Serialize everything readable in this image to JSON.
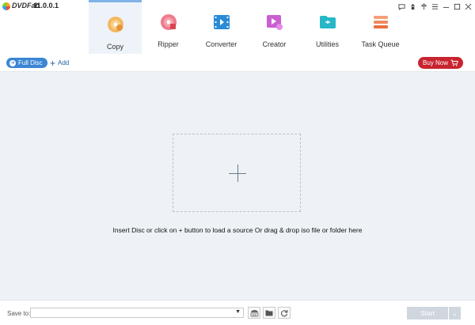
{
  "app": {
    "name": "DVDFab",
    "version": "11.0.0.1"
  },
  "toolbar": {
    "items": [
      {
        "label": "Copy",
        "icon": "copy-disc-icon",
        "active": true,
        "color": "#f0a640"
      },
      {
        "label": "Ripper",
        "icon": "ripper-disc-icon",
        "active": false,
        "color": "#e8556a"
      },
      {
        "label": "Converter",
        "icon": "converter-film-icon",
        "active": false,
        "color": "#2a8bd6"
      },
      {
        "label": "Creator",
        "icon": "creator-video-icon",
        "active": false,
        "color": "#c95fd0"
      },
      {
        "label": "Utilities",
        "icon": "utilities-folder-icon",
        "active": false,
        "color": "#26b7c8"
      },
      {
        "label": "Task Queue",
        "icon": "task-queue-icon",
        "active": false,
        "color": "#f08a5d"
      }
    ]
  },
  "source": {
    "full_disc_label": "Full Disc",
    "add_label": "Add",
    "buy_now_label": "Buy Now"
  },
  "main": {
    "hint": "Insert Disc or click on + button to load a source Or drag & drop iso file or folder here"
  },
  "bottom": {
    "save_to_label": "Save to:",
    "save_to_value": "",
    "start_label": "Start"
  },
  "colors": {
    "accent": "#3b86d4",
    "buy_now": "#c8242f",
    "workspace": "#eef2f7",
    "start_disabled": "#cfd6de"
  }
}
